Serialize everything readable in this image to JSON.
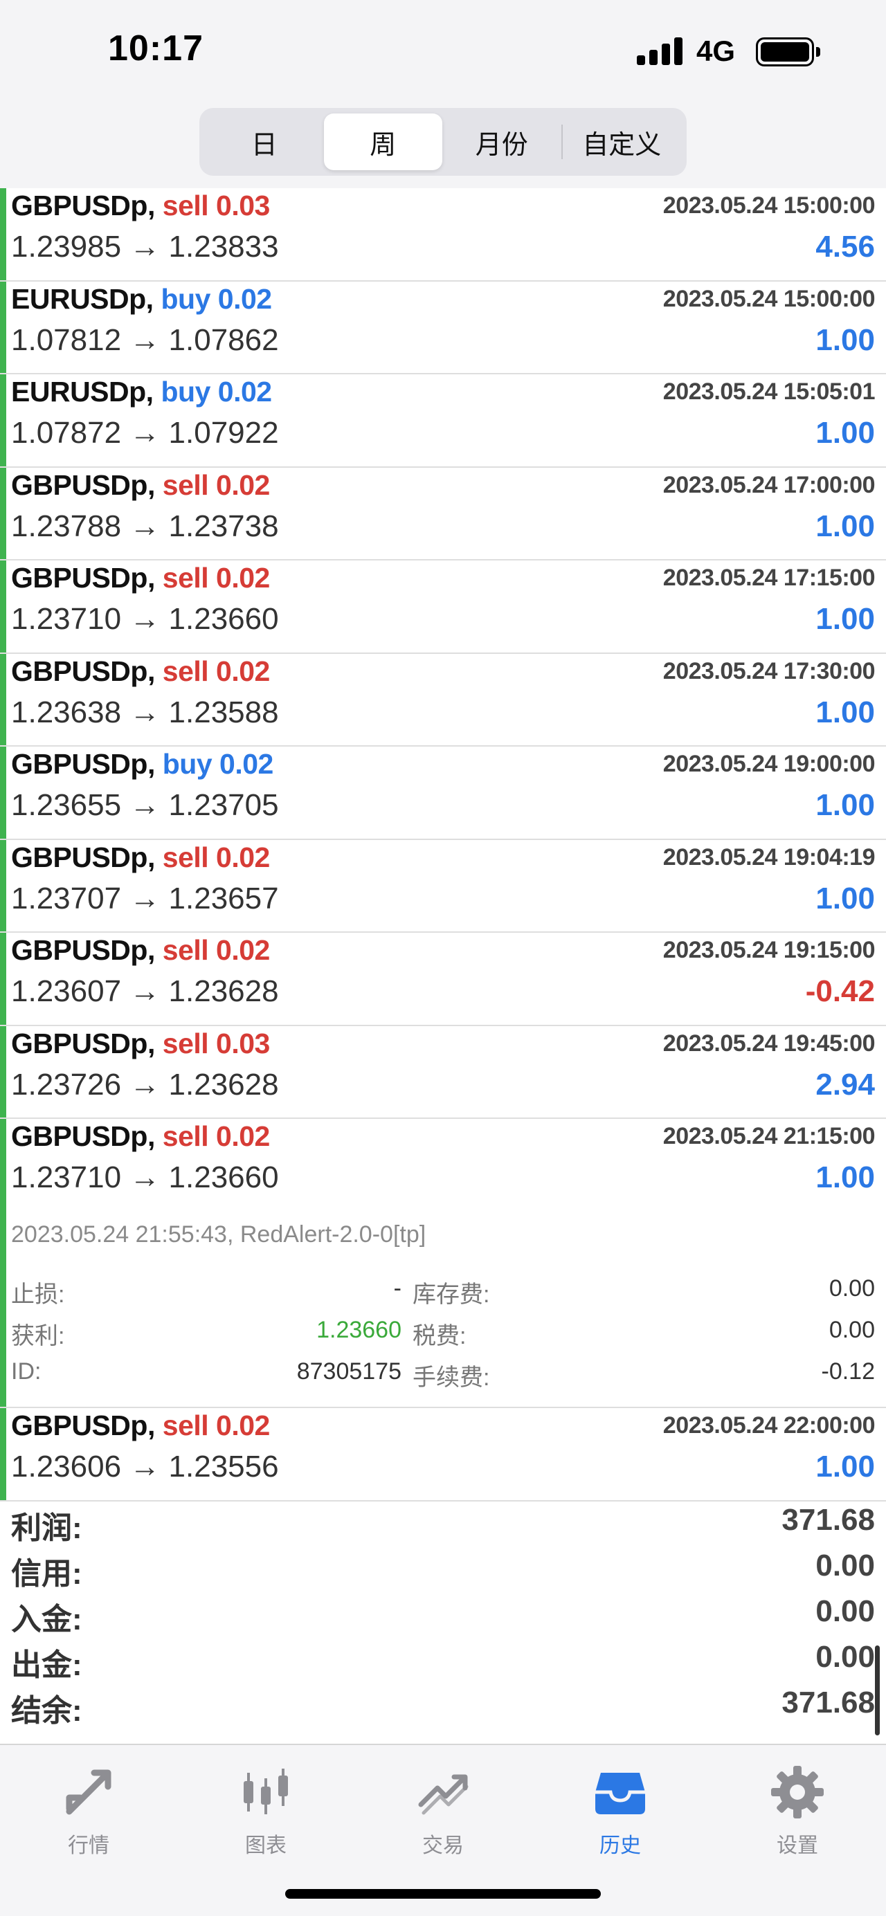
{
  "status_bar": {
    "time": "10:17",
    "network": "4G"
  },
  "period_tabs": [
    {
      "label": "日",
      "active": false
    },
    {
      "label": "周",
      "active": true
    },
    {
      "label": "月份",
      "active": false
    },
    {
      "label": "自定义",
      "active": false
    }
  ],
  "deals": [
    {
      "symbol": "GBPUSDp,",
      "side": "sell",
      "volume": "0.03",
      "side_text": "sell 0.03",
      "time": "2023.05.24 15:00:00",
      "open": "1.23985",
      "close": "1.23833",
      "profit": "4.56"
    },
    {
      "symbol": "EURUSDp,",
      "side": "buy",
      "volume": "0.02",
      "side_text": "buy 0.02",
      "time": "2023.05.24 15:00:00",
      "open": "1.07812",
      "close": "1.07862",
      "profit": "1.00"
    },
    {
      "symbol": "EURUSDp,",
      "side": "buy",
      "volume": "0.02",
      "side_text": "buy 0.02",
      "time": "2023.05.24 15:05:01",
      "open": "1.07872",
      "close": "1.07922",
      "profit": "1.00"
    },
    {
      "symbol": "GBPUSDp,",
      "side": "sell",
      "volume": "0.02",
      "side_text": "sell 0.02",
      "time": "2023.05.24 17:00:00",
      "open": "1.23788",
      "close": "1.23738",
      "profit": "1.00"
    },
    {
      "symbol": "GBPUSDp,",
      "side": "sell",
      "volume": "0.02",
      "side_text": "sell 0.02",
      "time": "2023.05.24 17:15:00",
      "open": "1.23710",
      "close": "1.23660",
      "profit": "1.00"
    },
    {
      "symbol": "GBPUSDp,",
      "side": "sell",
      "volume": "0.02",
      "side_text": "sell 0.02",
      "time": "2023.05.24 17:30:00",
      "open": "1.23638",
      "close": "1.23588",
      "profit": "1.00"
    },
    {
      "symbol": "GBPUSDp,",
      "side": "buy",
      "volume": "0.02",
      "side_text": "buy 0.02",
      "time": "2023.05.24 19:00:00",
      "open": "1.23655",
      "close": "1.23705",
      "profit": "1.00"
    },
    {
      "symbol": "GBPUSDp,",
      "side": "sell",
      "volume": "0.02",
      "side_text": "sell 0.02",
      "time": "2023.05.24 19:04:19",
      "open": "1.23707",
      "close": "1.23657",
      "profit": "1.00"
    },
    {
      "symbol": "GBPUSDp,",
      "side": "sell",
      "volume": "0.02",
      "side_text": "sell 0.02",
      "time": "2023.05.24 19:15:00",
      "open": "1.23607",
      "close": "1.23628",
      "profit": "-0.42"
    },
    {
      "symbol": "GBPUSDp,",
      "side": "sell",
      "volume": "0.03",
      "side_text": "sell 0.03",
      "time": "2023.05.24 19:45:00",
      "open": "1.23726",
      "close": "1.23628",
      "profit": "2.94"
    },
    {
      "symbol": "GBPUSDp,",
      "side": "sell",
      "volume": "0.02",
      "side_text": "sell 0.02",
      "time": "2023.05.24 21:15:00",
      "open": "1.23710",
      "close": "1.23660",
      "profit": "1.00"
    },
    {
      "symbol": "GBPUSDp,",
      "side": "sell",
      "volume": "0.02",
      "side_text": "sell 0.02",
      "time": "2023.05.24 22:00:00",
      "open": "1.23606",
      "close": "1.23556",
      "profit": "1.00"
    }
  ],
  "arrow": "→",
  "expanded_detail": {
    "header": "2023.05.24 21:55:43, RedAlert-2.0-0[tp]",
    "rows": [
      {
        "label1": "止损:",
        "value1": "-",
        "label2": "库存费:",
        "value2": "0.00"
      },
      {
        "label1": "获利:",
        "value1": "1.23660",
        "label2": "税费:",
        "value2": "0.00"
      },
      {
        "label1": "ID:",
        "value1": "87305175",
        "label2": "手续费:",
        "value2": "-0.12"
      }
    ]
  },
  "summary": [
    {
      "label": "利润:",
      "value": "371.68"
    },
    {
      "label": "信用:",
      "value": "0.00"
    },
    {
      "label": "入金:",
      "value": "0.00"
    },
    {
      "label": "出金:",
      "value": "0.00"
    },
    {
      "label": "结余:",
      "value": "371.68"
    }
  ],
  "tabbar": [
    {
      "label": "行情",
      "icon": "quotes-icon",
      "active": false
    },
    {
      "label": "图表",
      "icon": "chart-icon",
      "active": false
    },
    {
      "label": "交易",
      "icon": "trade-icon",
      "active": false
    },
    {
      "label": "历史",
      "icon": "history-icon",
      "active": true
    },
    {
      "label": "设置",
      "icon": "settings-icon",
      "active": false
    }
  ],
  "colors": {
    "sell": "#d63c36",
    "buy": "#2b78e4",
    "positive": "#2b78e4",
    "negative": "#d63c36",
    "accent_bar": "#3fb34f",
    "take_profit": "#3aa93a"
  }
}
